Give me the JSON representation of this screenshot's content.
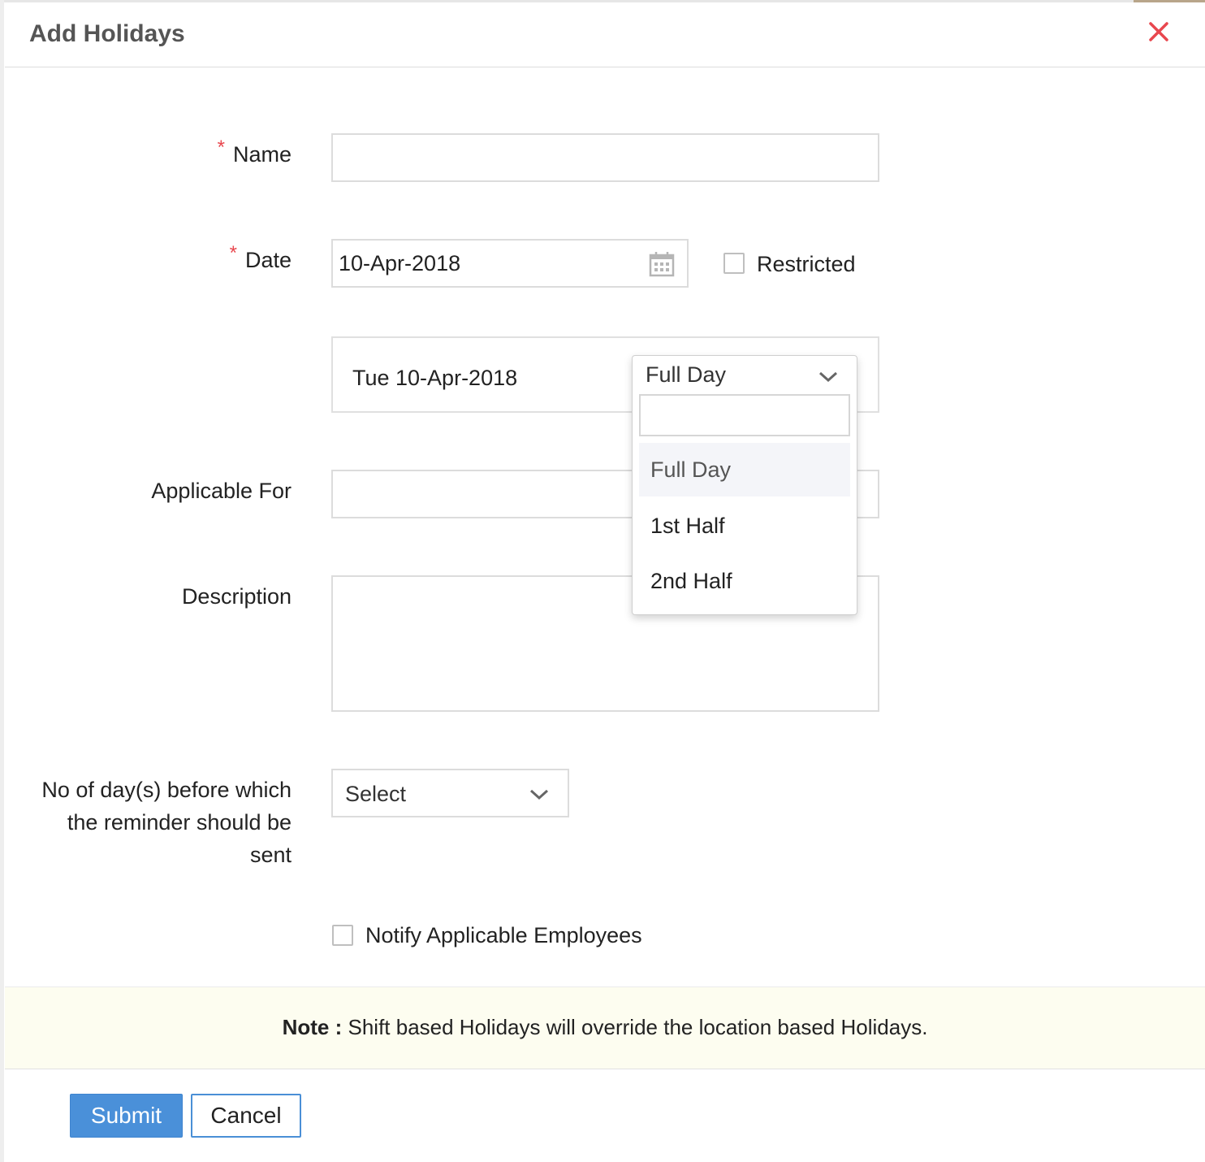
{
  "dialog": {
    "title": "Add Holidays",
    "close_icon": "close-icon"
  },
  "form": {
    "required_marker": "*",
    "name": {
      "label": "Name",
      "value": ""
    },
    "date": {
      "label": "Date",
      "value": "10-Apr-2018",
      "icon": "calendar-icon"
    },
    "restricted": {
      "label": "Restricted",
      "checked": false
    },
    "day_row": {
      "day_label": "Tue 10-Apr-2018"
    },
    "day_type": {
      "selected": "Full Day",
      "search_value": "",
      "options": [
        "Full Day",
        "1st Half",
        "2nd Half"
      ],
      "highlighted_index": 0
    },
    "applicable_for": {
      "label": "Applicable For",
      "value": ""
    },
    "description": {
      "label": "Description",
      "value": ""
    },
    "reminder": {
      "label_lines": [
        "No of day(s) before which",
        "the reminder should be",
        "sent"
      ],
      "selected": "Select"
    },
    "notify": {
      "label": "Notify Applicable Employees",
      "checked": false
    }
  },
  "note": {
    "label": "Note :",
    "text": "Shift based Holidays will override the location based Holidays."
  },
  "buttons": {
    "submit": "Submit",
    "cancel": "Cancel"
  },
  "colors": {
    "required": "#e8474e",
    "close": "#e8474e",
    "primary": "#4a90d9",
    "note_bg": "#fdfdf0"
  }
}
